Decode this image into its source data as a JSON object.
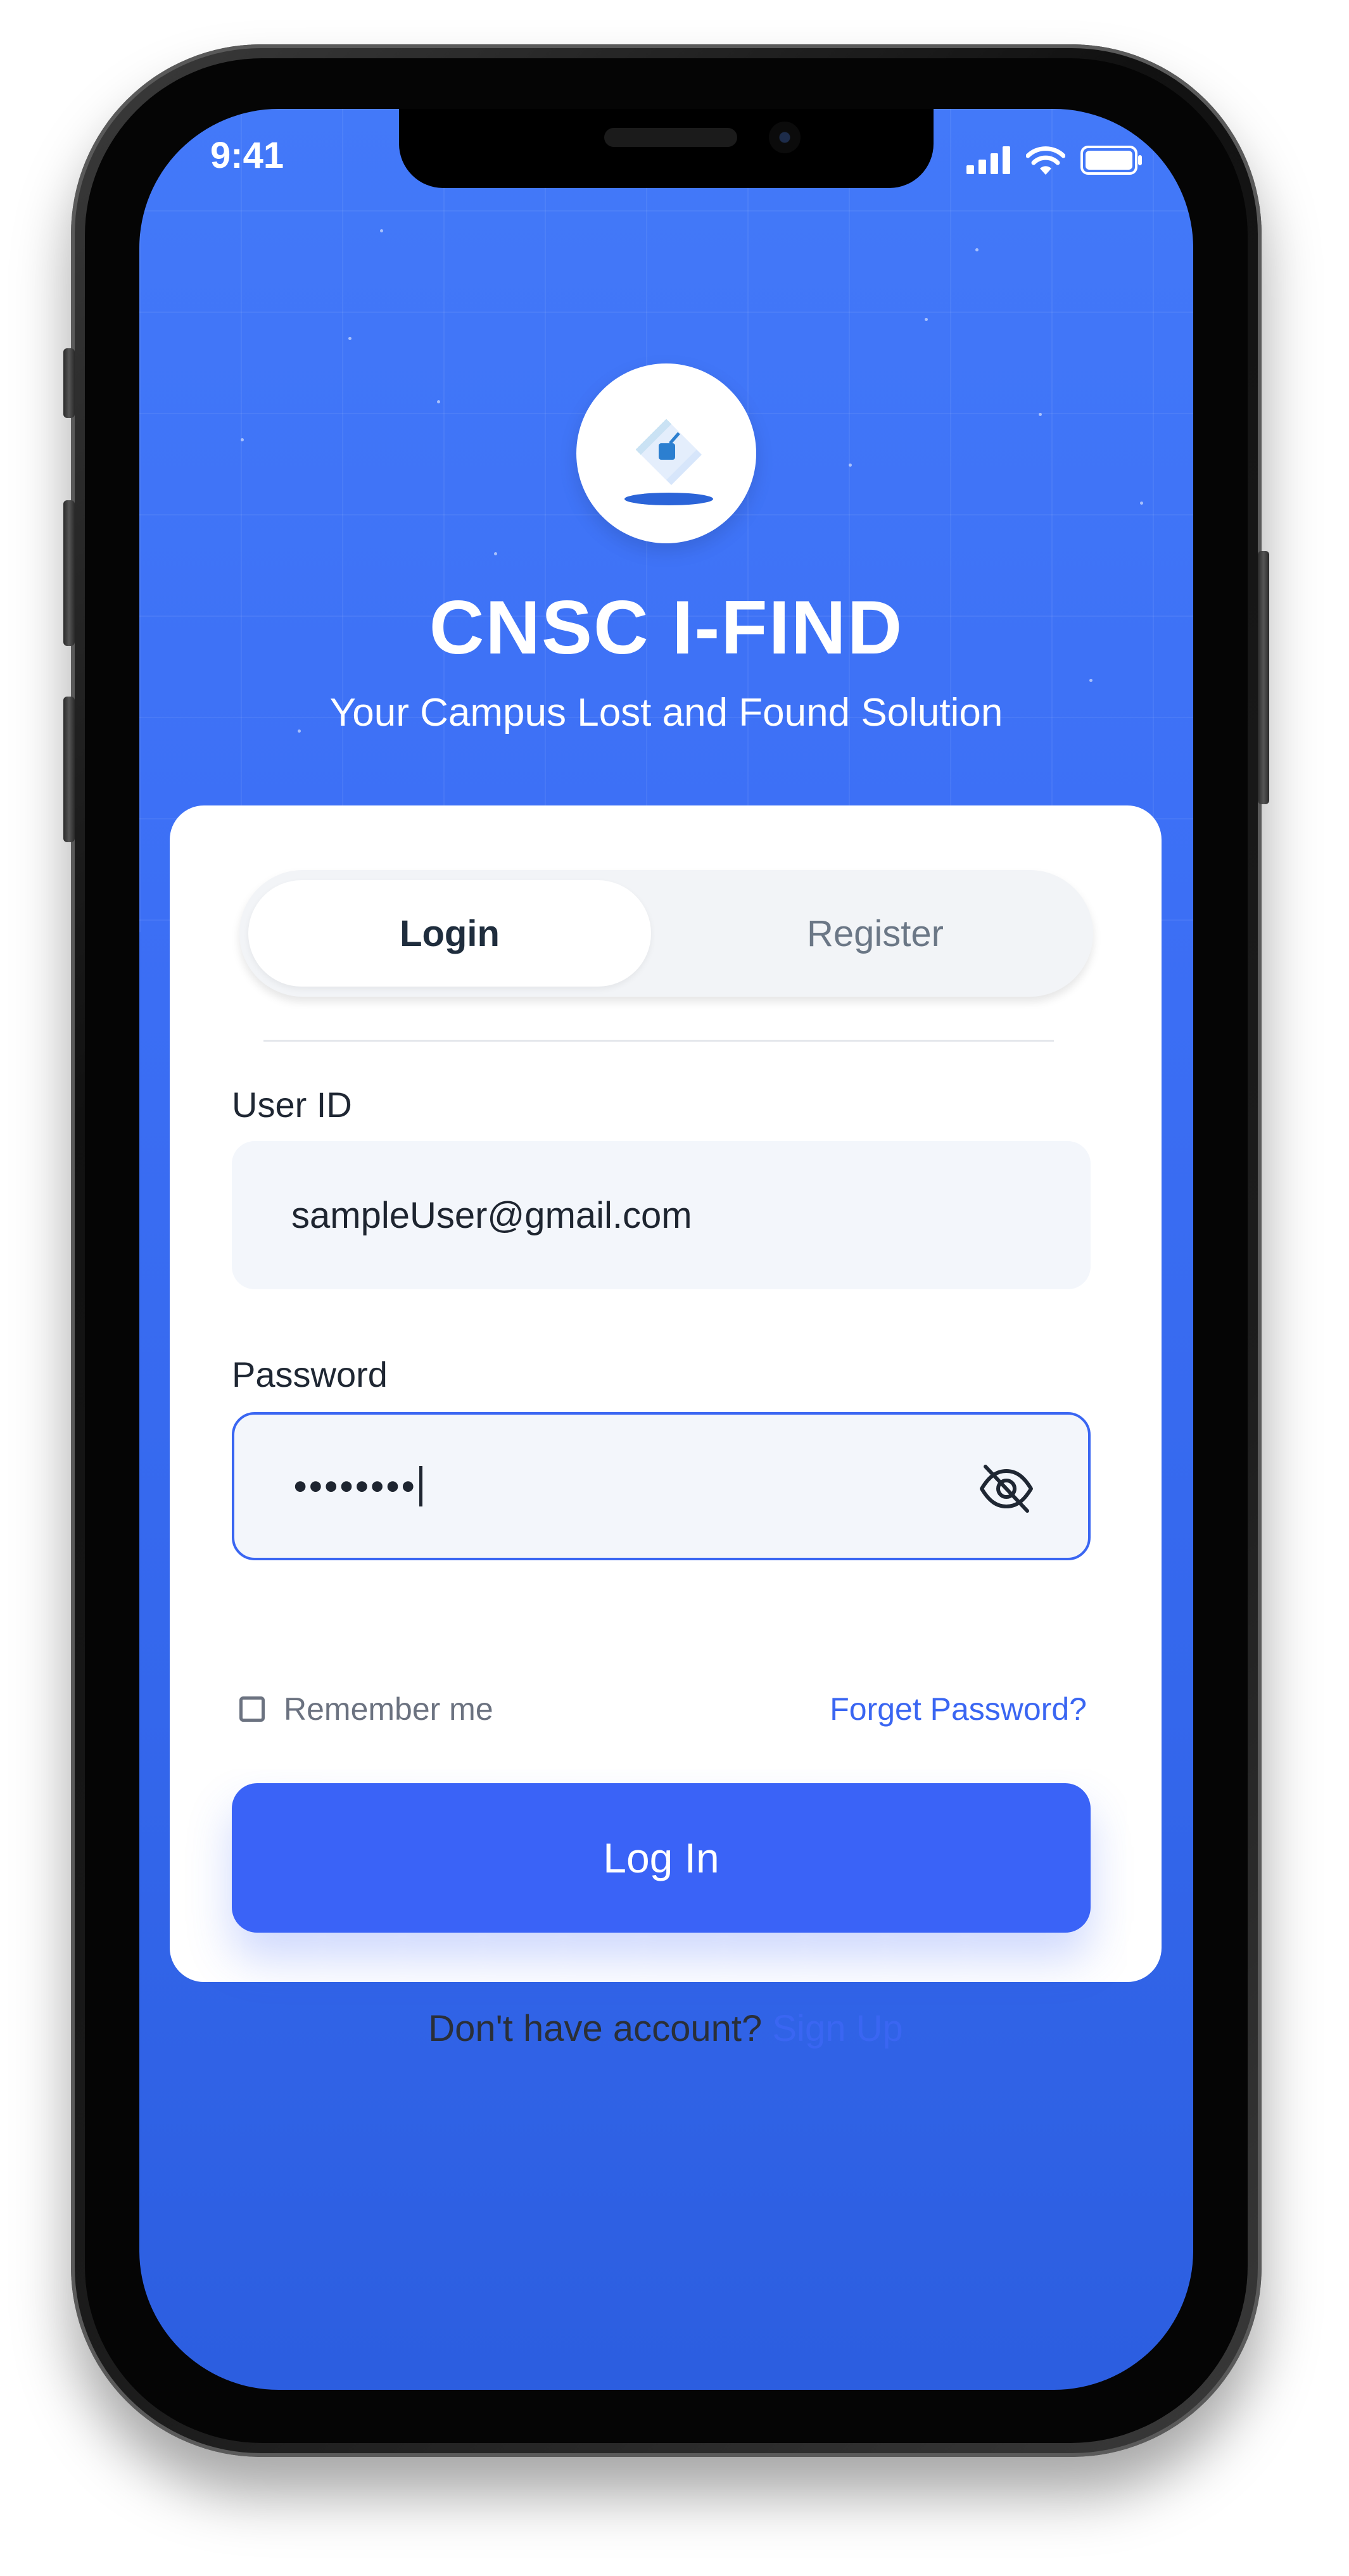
{
  "status_bar": {
    "time": "9:41",
    "icons": [
      "signal-icon",
      "wifi-icon",
      "battery-icon"
    ]
  },
  "app": {
    "logo_icon": "diamond-logo-icon",
    "title": "CNSC I-FIND",
    "subtitle": "Your Campus Lost and Found Solution"
  },
  "tabs": {
    "login_label": "Login",
    "register_label": "Register",
    "active": "Login"
  },
  "form": {
    "user_id_label": "User ID",
    "user_id_value": "sampleUser@gmail.com",
    "password_label": "Password",
    "password_value": "••••••••",
    "password_toggle_icon": "eye-off-icon",
    "remember_label": "Remember me",
    "remember_checked": false,
    "forgot_label": "Forget Password?",
    "login_button_label": "Log In",
    "no_account_text": "Don't have account? ",
    "signup_label": "Sign Up"
  },
  "colors": {
    "primary": "#3a63f7",
    "background_top": "#4379f9",
    "background_bottom": "#2c5ee0",
    "link": "#3a66f2"
  }
}
